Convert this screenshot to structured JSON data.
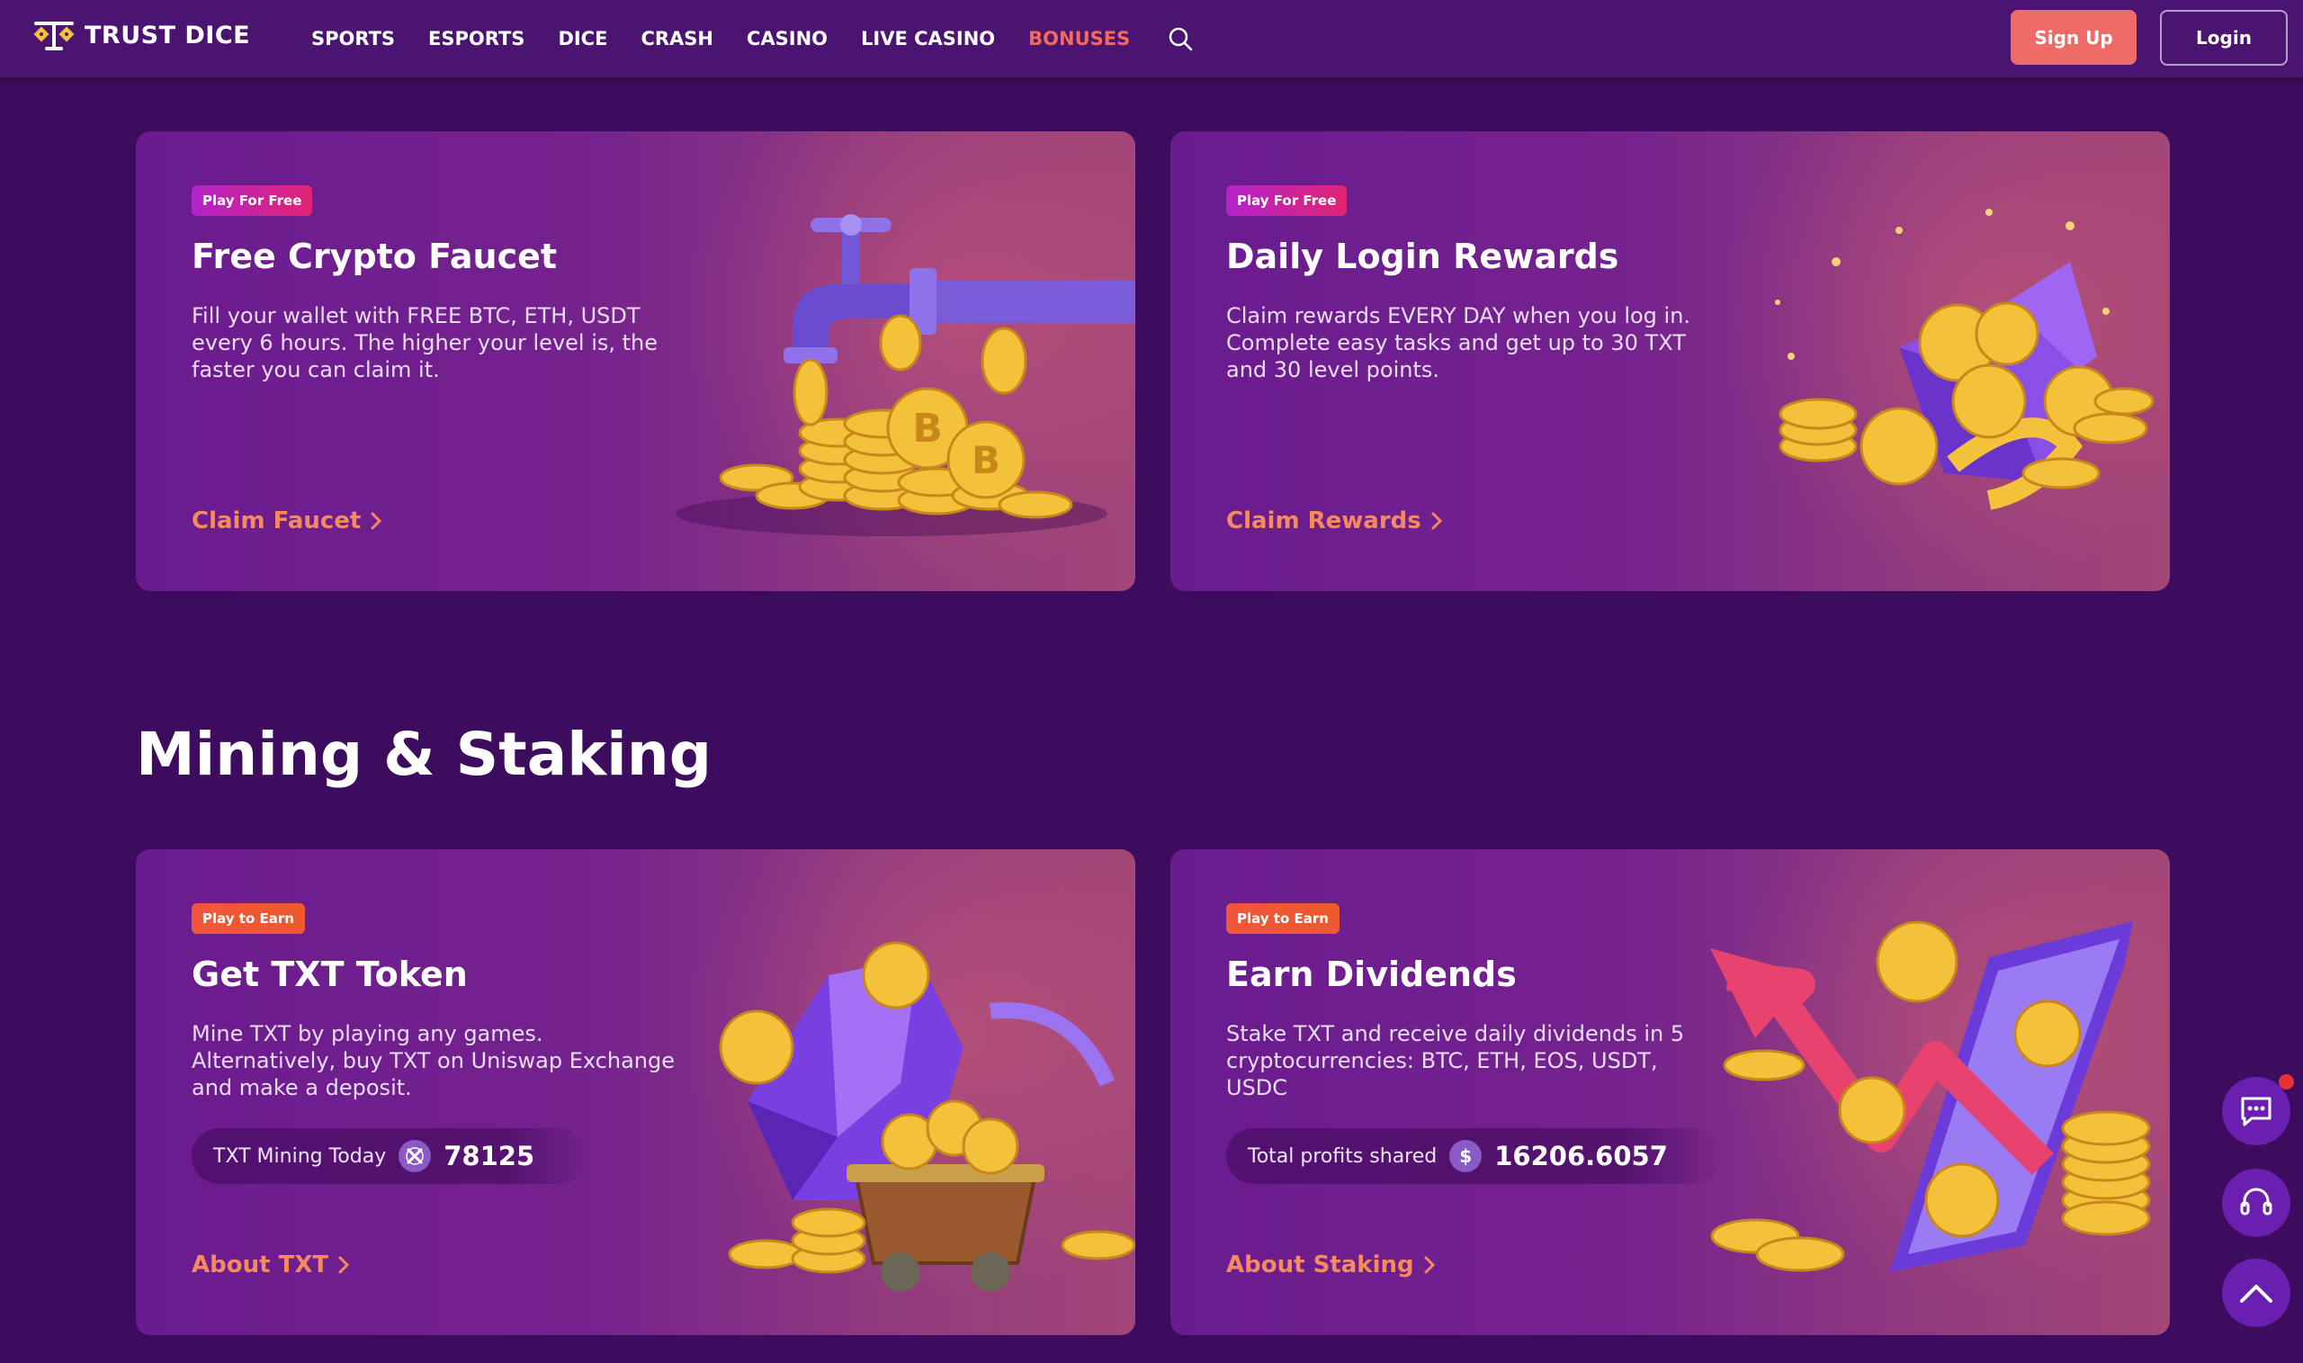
{
  "brand": {
    "name": "TRUST DICE"
  },
  "nav": {
    "items": [
      {
        "label": "SPORTS",
        "active": false
      },
      {
        "label": "ESPORTS",
        "active": false
      },
      {
        "label": "DICE",
        "active": false
      },
      {
        "label": "CRASH",
        "active": false
      },
      {
        "label": "CASINO",
        "active": false
      },
      {
        "label": "LIVE CASINO",
        "active": false
      },
      {
        "label": "BONUSES",
        "active": true
      }
    ],
    "search_icon": "search-icon"
  },
  "auth": {
    "signup_label": "Sign Up",
    "login_label": "Login"
  },
  "free_section": {
    "cards": [
      {
        "badge": "Play For Free",
        "title": "Free Crypto Faucet",
        "description": "Fill your wallet with FREE BTC, ETH, USDT every 6 hours. The higher your level is, the faster you can claim it.",
        "link": "Claim Faucet",
        "illustration": "faucet-coins-icon"
      },
      {
        "badge": "Play For Free",
        "title": "Daily Login Rewards",
        "description": "Claim rewards EVERY DAY when you log in. Complete easy tasks and get up to 30 TXT and 30 level points.",
        "link": "Claim Rewards",
        "illustration": "gift-box-coins-icon"
      }
    ]
  },
  "mining_section": {
    "title": "Mining & Staking",
    "cards": [
      {
        "badge": "Play to Earn",
        "title": "Get TXT Token",
        "description": "Mine TXT by playing any games. Alternatively, buy TXT on Uniswap Exchange and make a deposit.",
        "stat_label": "TXT Mining Today",
        "stat_value": "78125",
        "stat_icon": "txt-token-icon",
        "link": "About TXT",
        "illustration": "mine-cart-crystal-icon"
      },
      {
        "badge": "Play to Earn",
        "title": "Earn Dividends",
        "description": "Stake TXT and receive daily dividends in 5 cryptocurrencies: BTC, ETH, EOS, USDT, USDC",
        "stat_label": "Total profits shared",
        "stat_value": "16206.6057",
        "stat_icon": "dollar-icon",
        "stat_icon_glyph": "$",
        "link": "About Staking",
        "illustration": "phone-arrow-coins-icon"
      }
    ]
  },
  "floating": {
    "chat_icon": "chat-icon",
    "support_icon": "headset-icon",
    "scroll_top_icon": "chevron-up-icon"
  },
  "colors": {
    "background": "#3e0c5e",
    "header": "#4b1470",
    "accent": "#ef6b67",
    "link": "#f58a5f",
    "gold": "#f4c23a"
  }
}
